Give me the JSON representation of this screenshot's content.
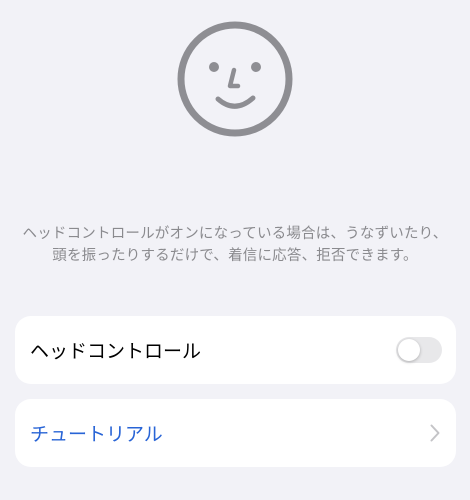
{
  "header": {
    "icon": "face-smile-icon",
    "icon_color": "#8e8e93"
  },
  "description": {
    "text": "ヘッドコントロールがオンになっている場合は、うなずいたり、頭を振ったりするだけで、着信に応答、拒否できます。"
  },
  "settings": {
    "head_control": {
      "label": "ヘッドコントロール",
      "enabled": false
    },
    "tutorial": {
      "label": "チュートリアル",
      "color": "#2864d6"
    }
  }
}
